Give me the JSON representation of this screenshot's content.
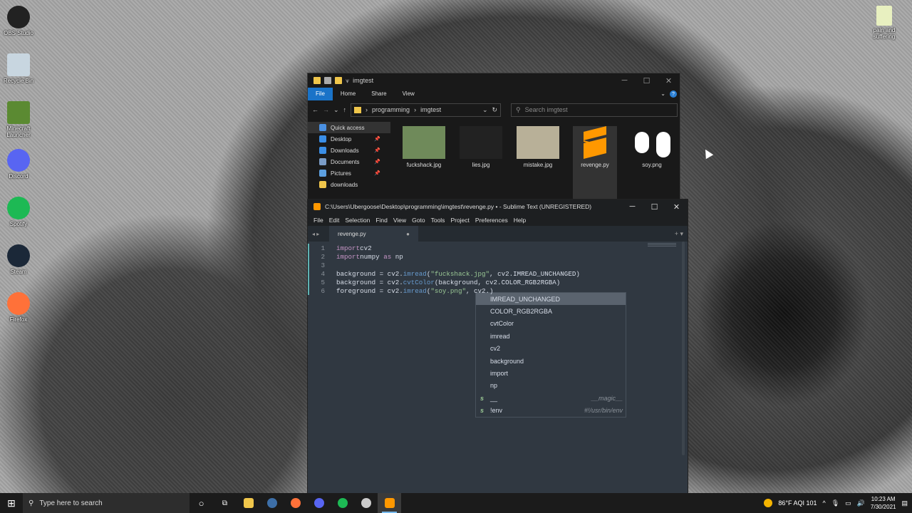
{
  "desktop": {
    "icons": [
      {
        "label": "OBS Studio",
        "icon": "obs-icon",
        "color": "#222222"
      },
      {
        "label": "Recycle Bin",
        "icon": "recycle-bin-icon",
        "color": "#c8d6e0"
      },
      {
        "label": "Minecraft Launcher",
        "icon": "minecraft-icon",
        "color": "#5b8a32"
      },
      {
        "label": "Discord",
        "icon": "discord-icon",
        "color": "#5865f2"
      },
      {
        "label": "Spotify",
        "icon": "spotify-icon",
        "color": "#1db954"
      },
      {
        "label": "Steam",
        "icon": "steam-icon",
        "color": "#1b2838"
      },
      {
        "label": "Firefox",
        "icon": "firefox-icon",
        "color": "#ff7139"
      }
    ],
    "right_icon": {
      "label": "pain and suffering",
      "icon": "file-icon"
    }
  },
  "explorer": {
    "title": "imgtest",
    "ribbon": [
      "File",
      "Home",
      "Share",
      "View"
    ],
    "breadcrumb": [
      "programming",
      "imgtest"
    ],
    "search_placeholder": "Search imgtest",
    "nav": [
      {
        "label": "Quick access",
        "icon": "star-icon",
        "color": "#4a90e2",
        "pin": ""
      },
      {
        "label": "Desktop",
        "icon": "desktop-icon",
        "color": "#3a8ee6",
        "pin": "📌"
      },
      {
        "label": "Downloads",
        "icon": "download-icon",
        "color": "#3a8ee6",
        "pin": "📌"
      },
      {
        "label": "Documents",
        "icon": "documents-icon",
        "color": "#7a9cc6",
        "pin": "📌"
      },
      {
        "label": "Pictures",
        "icon": "pictures-icon",
        "color": "#5da0e0",
        "pin": "📌"
      },
      {
        "label": "downloads",
        "icon": "folder-icon",
        "color": "#f0c64b",
        "pin": ""
      }
    ],
    "files": [
      {
        "name": "fuckshack.jpg",
        "icon": "image-thumb",
        "color": "#6f8a5a"
      },
      {
        "name": "lies.jpg",
        "icon": "image-thumb",
        "color": "#222222"
      },
      {
        "name": "mistake.jpg",
        "icon": "image-thumb",
        "color": "#b8b098"
      },
      {
        "name": "revenge.py",
        "icon": "sublime-file-icon",
        "color": "#ff9800"
      },
      {
        "name": "soy.png",
        "icon": "image-thumb",
        "color": "#ffffff"
      }
    ]
  },
  "sublime": {
    "title": "C:\\Users\\Ubergoose\\Desktop\\programming\\imgtest\\revenge.py • - Sublime Text (UNREGISTERED)",
    "menu": [
      "File",
      "Edit",
      "Selection",
      "Find",
      "View",
      "Goto",
      "Tools",
      "Project",
      "Preferences",
      "Help"
    ],
    "tab": "revenge.py",
    "tab_dot": "●",
    "lines": [
      {
        "n": "1",
        "parts": [
          [
            "kw",
            "import"
          ],
          [
            "",
            "cv2"
          ]
        ]
      },
      {
        "n": "2",
        "parts": [
          [
            "kw",
            "import"
          ],
          [
            "",
            "numpy "
          ],
          [
            "kw",
            "as"
          ],
          [
            "",
            " np"
          ]
        ]
      },
      {
        "n": "3",
        "parts": []
      },
      {
        "n": "4",
        "parts": [
          [
            "",
            "background = cv2."
          ],
          [
            "fn",
            "imread"
          ],
          [
            "",
            "("
          ],
          [
            "st",
            "\"fuckshack.jpg\""
          ],
          [
            "",
            ", cv2.IMREAD_UNCHANGED)"
          ]
        ]
      },
      {
        "n": "5",
        "parts": [
          [
            "",
            "background = cv2."
          ],
          [
            "fn",
            "cvtColor"
          ],
          [
            "",
            "(background, cv2.COLOR_RGB2RGBA)"
          ]
        ]
      },
      {
        "n": "6",
        "parts": [
          [
            "",
            "foreground = cv2."
          ],
          [
            "fn",
            "imread"
          ],
          [
            "",
            "("
          ],
          [
            "st",
            "\"soy.png\""
          ],
          [
            "",
            ", cv2.)"
          ]
        ]
      }
    ],
    "autocomplete": [
      {
        "label": "IMREAD_UNCHANGED",
        "kind": "",
        "hint": ""
      },
      {
        "label": "COLOR_RGB2RGBA",
        "kind": "",
        "hint": ""
      },
      {
        "label": "cvtColor",
        "kind": "",
        "hint": ""
      },
      {
        "label": "imread",
        "kind": "",
        "hint": ""
      },
      {
        "label": "cv2",
        "kind": "",
        "hint": ""
      },
      {
        "label": "background",
        "kind": "",
        "hint": ""
      },
      {
        "label": "import",
        "kind": "",
        "hint": ""
      },
      {
        "label": "np",
        "kind": "",
        "hint": ""
      },
      {
        "label": "__",
        "kind": "s",
        "hint": "__magic__"
      },
      {
        "label": "!env",
        "kind": "s",
        "hint": "#!/usr/bin/env"
      }
    ]
  },
  "taskbar": {
    "search_placeholder": "Type here to search",
    "apps": [
      {
        "name": "file-explorer",
        "icon": "folder-icon",
        "color": "#f0c64b"
      },
      {
        "name": "steam",
        "icon": "steam-icon",
        "color": "#3d6fa8"
      },
      {
        "name": "firefox",
        "icon": "firefox-icon",
        "color": "#ff7139"
      },
      {
        "name": "discord",
        "icon": "discord-icon",
        "color": "#5865f2"
      },
      {
        "name": "spotify",
        "icon": "spotify-icon",
        "color": "#1db954"
      },
      {
        "name": "obs",
        "icon": "obs-icon",
        "color": "#cccccc"
      },
      {
        "name": "sublime",
        "icon": "sublime-icon",
        "color": "#ff9800"
      }
    ],
    "weather": "86°F  AQI 101",
    "time": "10:23 AM",
    "date": "7/30/2021"
  }
}
